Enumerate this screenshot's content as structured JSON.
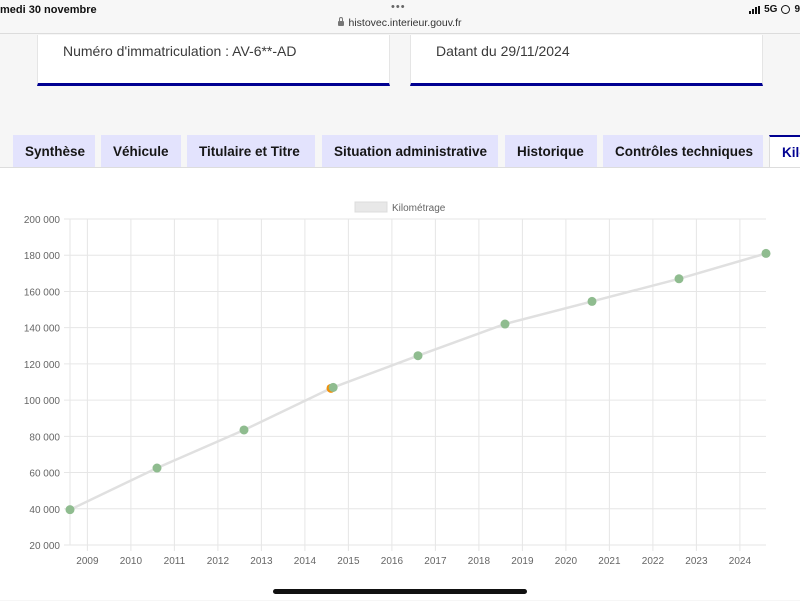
{
  "status_bar": {
    "time": "medi 30 novembre",
    "url": "histovec.interieur.gouv.fr",
    "network": "5G",
    "battery": "9"
  },
  "cards": {
    "immatriculation": "Numéro d'immatriculation : AV-6**-AD",
    "date": "Datant du 29/11/2024"
  },
  "tabs": [
    {
      "label": "Synthèse"
    },
    {
      "label": "Véhicule"
    },
    {
      "label": "Titulaire et Titre"
    },
    {
      "label": "Situation administrative"
    },
    {
      "label": "Historique"
    },
    {
      "label": "Contrôles techniques"
    },
    {
      "label": "Kilo",
      "active": true
    }
  ],
  "chart_data": {
    "type": "line",
    "legend": "Kilométrage",
    "xlim": [
      2008.6,
      2024.6
    ],
    "ylim": [
      20000,
      200000
    ],
    "x_ticks": [
      "2009",
      "2010",
      "2011",
      "2012",
      "2013",
      "2014",
      "2015",
      "2016",
      "2017",
      "2018",
      "2019",
      "2020",
      "2021",
      "2022",
      "2023",
      "2024"
    ],
    "y_ticks": [
      "20 000",
      "40 000",
      "60 000",
      "80 000",
      "100 000",
      "120 000",
      "140 000",
      "160 000",
      "180 000",
      "200 000"
    ],
    "line_color": "#e0e0e0",
    "points": [
      {
        "x": 2008.6,
        "y": 39500,
        "color": "#8fbc8f"
      },
      {
        "x": 2010.6,
        "y": 62500,
        "color": "#8fbc8f"
      },
      {
        "x": 2012.6,
        "y": 83500,
        "color": "#8fbc8f"
      },
      {
        "x": 2014.6,
        "y": 106500,
        "color": "#f0900a"
      },
      {
        "x": 2014.65,
        "y": 107000,
        "color": "#8fbc8f"
      },
      {
        "x": 2016.6,
        "y": 124500,
        "color": "#8fbc8f"
      },
      {
        "x": 2018.6,
        "y": 142000,
        "color": "#8fbc8f"
      },
      {
        "x": 2020.6,
        "y": 154500,
        "color": "#8fbc8f"
      },
      {
        "x": 2022.6,
        "y": 167000,
        "color": "#8fbc8f"
      },
      {
        "x": 2024.6,
        "y": 181000,
        "color": "#8fbc8f"
      }
    ]
  }
}
